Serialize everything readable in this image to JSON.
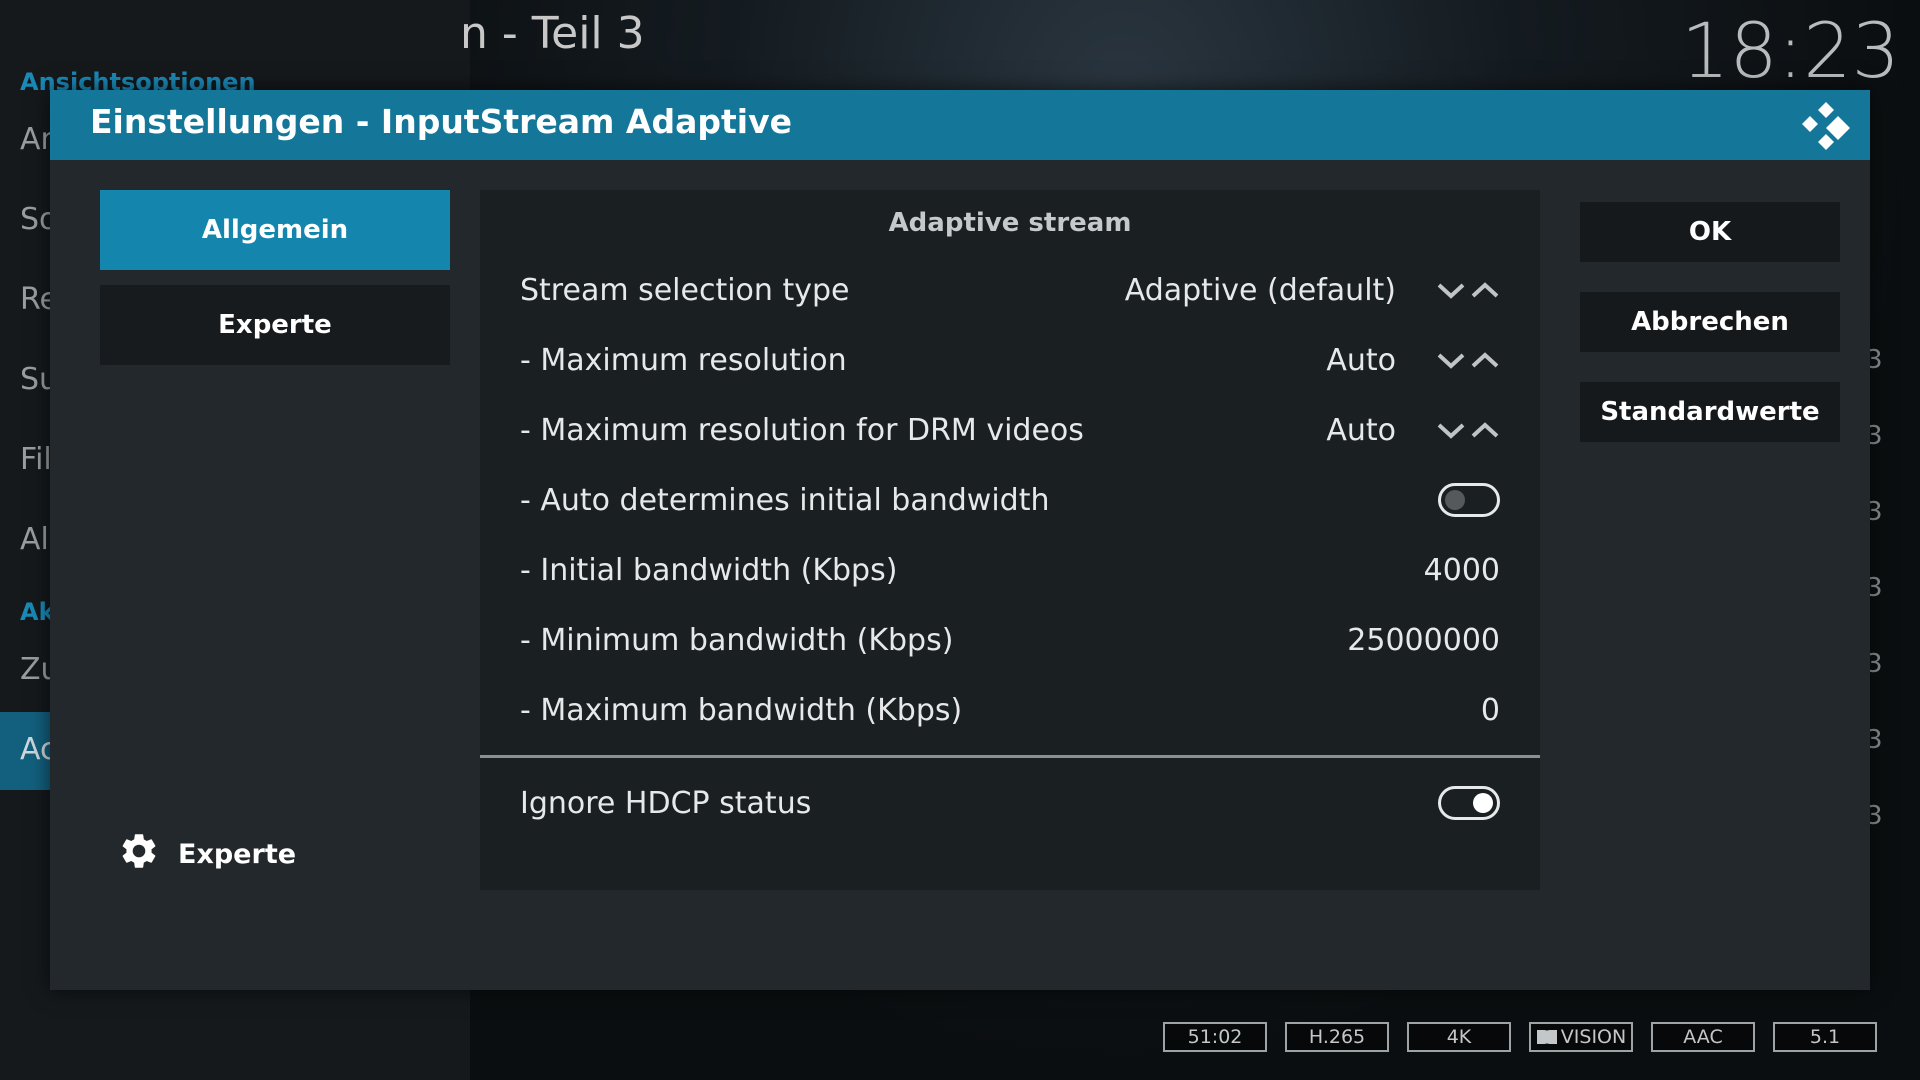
{
  "background": {
    "title": "n - Teil 3",
    "clock": "18:23",
    "section_1": "Ansichtsoptionen",
    "section_2": "Ak",
    "items": [
      "An",
      "So",
      "Re",
      "Su",
      "Fil",
      "All",
      "Zu"
    ],
    "selected_item": "Ac",
    "right_numbers": [
      "3",
      "3",
      "3",
      "3",
      "3",
      "3",
      "3"
    ]
  },
  "dialog": {
    "title": "Einstellungen - InputStream Adaptive",
    "logo_icon": "kodi-logo-icon",
    "categories": [
      {
        "label": "Allgemein",
        "active": true
      },
      {
        "label": "Experte",
        "active": false
      }
    ],
    "level": {
      "icon": "gear-icon",
      "label": "Experte"
    },
    "section_heading": "Adaptive stream",
    "settings": [
      {
        "label": "Stream selection type",
        "value": "Adaptive (default)",
        "control": "spinner"
      },
      {
        "label": "- Maximum resolution",
        "value": "Auto",
        "control": "spinner"
      },
      {
        "label": "- Maximum resolution for DRM videos",
        "value": "Auto",
        "control": "spinner"
      },
      {
        "label": "- Auto determines initial bandwidth",
        "value": "",
        "control": "toggle-off"
      },
      {
        "label": "- Initial bandwidth (Kbps)",
        "value": "4000",
        "control": "value"
      },
      {
        "label": "- Minimum bandwidth (Kbps)",
        "value": "25000000",
        "control": "value"
      },
      {
        "label": "- Maximum bandwidth (Kbps)",
        "value": "0",
        "control": "value"
      },
      {
        "label": "Ignore HDCP status",
        "value": "",
        "control": "toggle-on"
      }
    ],
    "buttons": {
      "ok": "OK",
      "cancel": "Abbrechen",
      "defaults": "Standardwerte"
    }
  },
  "badges": [
    "51:02",
    "H.265",
    "4K",
    "VISION",
    "AAC",
    "5.1"
  ],
  "colors": {
    "header": "#147799",
    "active_category": "#1486ad",
    "dialog_bg": "#22282c",
    "panel_bg": "#1a1f22"
  }
}
